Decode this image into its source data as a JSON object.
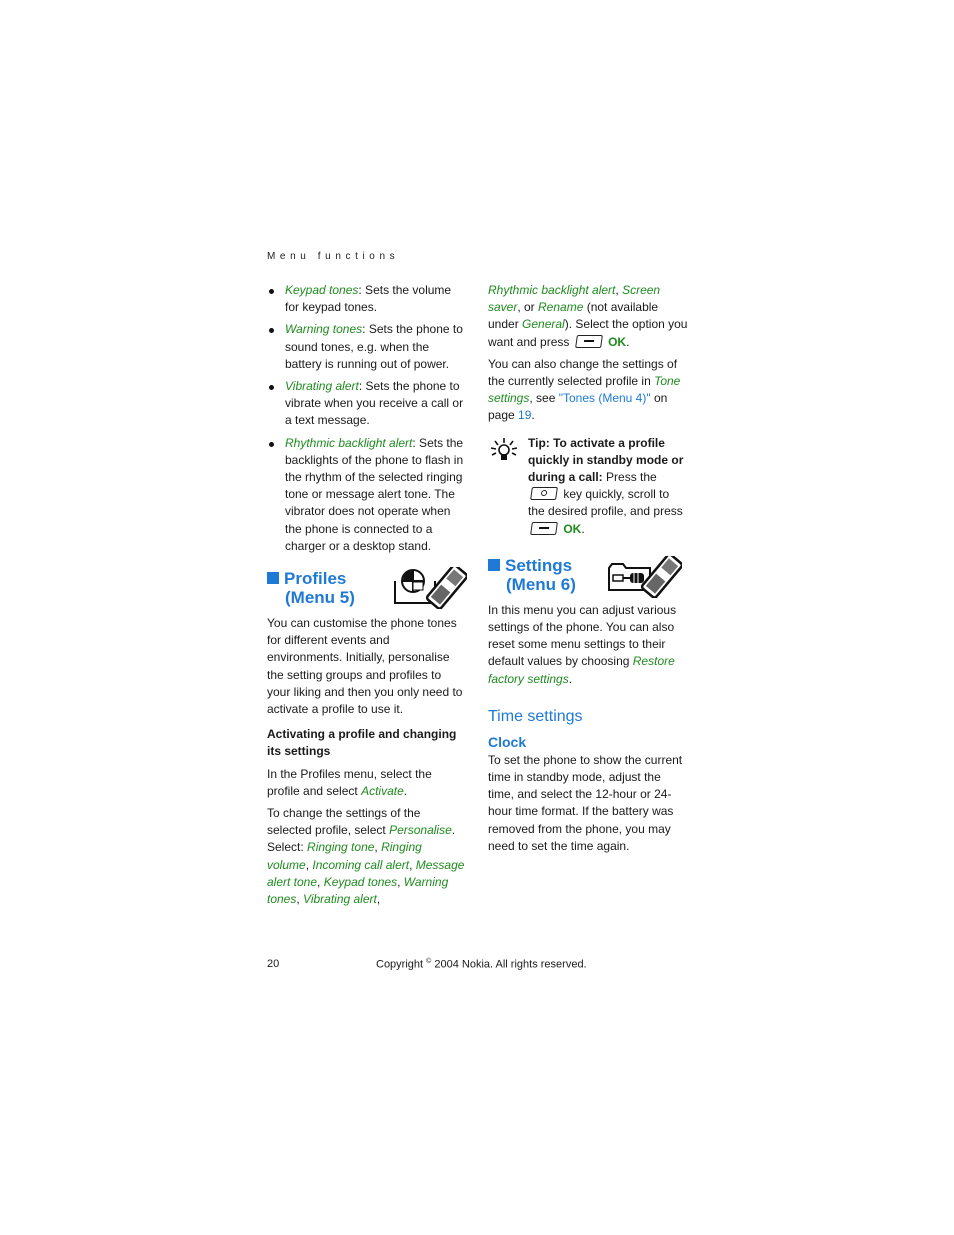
{
  "running_head": "Menu functions",
  "left_column": {
    "bullets": [
      {
        "term": "Keypad tones",
        "text": ": Sets the volume for keypad tones."
      },
      {
        "term": "Warning tones",
        "text": ": Sets the phone to sound tones, e.g. when the battery is running out of power."
      },
      {
        "term": "Vibrating alert",
        "text": ": Sets the phone to vibrate when you receive a call or a text message."
      },
      {
        "term": "Rhythmic backlight alert",
        "text": ": Sets the backlights of the phone to flash in the rhythm of the selected ringing tone or message alert tone. The vibrator does not operate when the phone is connected to a charger or a desktop stand."
      }
    ],
    "profiles": {
      "title_line1": "Profiles",
      "title_line2": "(Menu 5)",
      "icon": "profiles-phone-icon",
      "intro": "You can customise the phone tones for different events and environments. Initially, personalise the setting groups and profiles to your liking and then you only need to activate a profile to use it.",
      "subhead": "Activating a profile and changing its settings",
      "para1_pre": "In the Profiles menu, select the profile and select ",
      "para1_term": "Activate",
      "para1_post": ".",
      "para2_pre": "To change the settings of the selected profile, select ",
      "para2_term": "Personalise",
      "para2_mid": ". Select: ",
      "options": [
        "Ringing tone",
        "Ringing volume",
        "Incoming call alert",
        "Message alert tone",
        "Keypad tones",
        "Warning tones",
        "Vibrating alert"
      ]
    }
  },
  "right_column": {
    "cont_terms": [
      "Rhythmic backlight alert",
      "Screen saver",
      "Rename"
    ],
    "cont_or": ", or ",
    "cont_na_pre": " (not available under ",
    "cont_na_term": "General",
    "cont_na_post": "). Select the option you want and press ",
    "ok_label": "OK",
    "also_pre": "You can also change the settings of the currently selected profile in ",
    "also_term": "Tone settings",
    "also_mid": ", see ",
    "also_link": "\"Tones (Menu 4)\"",
    "also_on": " on page ",
    "also_page": "19",
    "tip": {
      "icon": "lightbulb-tip-icon",
      "bold": "Tip: To activate a profile quickly in standby mode or during a call:",
      "text1": " Press the ",
      "text2": " key quickly, scroll to the desired profile, and press ",
      "ok_label": "OK"
    },
    "settings": {
      "title_line1": "Settings",
      "title_line2": "(Menu 6)",
      "icon": "settings-phone-icon",
      "intro_pre": "In this menu you can adjust various settings of the phone. You can also reset some menu settings to their default values by choosing ",
      "intro_term": "Restore factory settings",
      "intro_post": ".",
      "time_heading": "Time settings",
      "clock_heading": "Clock",
      "clock_text": "To set the phone to show the current time in standby mode, adjust the time, and select the 12-hour or 24-hour time format. If the battery was removed from the phone, you may need to set the time again."
    }
  },
  "footer": {
    "page_number": "20",
    "copyright_pre": "Copyright ",
    "copyright_symbol": "©",
    "copyright_post": " 2004 Nokia. All rights reserved."
  },
  "colors": {
    "term_green": "#1f8a1f",
    "heading_blue": "#1f7ad6"
  }
}
